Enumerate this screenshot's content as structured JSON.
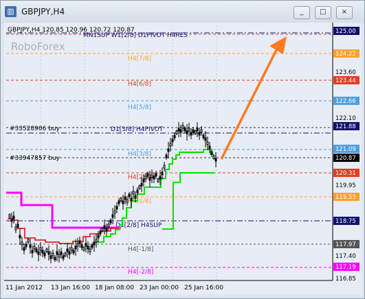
{
  "window": {
    "title": "GBPJPY,H4",
    "controls": [
      "_",
      "□",
      "×"
    ]
  },
  "chart": {
    "header": "GBPJPY,H4  120.85 120.96 120.72 120.87",
    "watermark": "RoboForex",
    "orders": [
      "#33528906 buy",
      "#33947857 buy"
    ],
    "level_labels": {
      "top": "MN1SUP W1[2/8] D1PIVOT H4RES",
      "h4_7_8": "H4[7/8]",
      "h4_6_8": "H4[6/8]",
      "h4_5_8": "H4[5/8]",
      "d1pivot": "D1[3/8] H4PIVOT",
      "h4_3_8": "H4[3/8]",
      "h4_2_8": "H4[2/8]",
      "h4_1_8": "H4[1/8]",
      "h4sup": "D1[2/8] H4SUP",
      "h4_m1_8": "H4[-1/8]",
      "h4_m2_8": "H4[-2/8]"
    },
    "price_axis": [
      "125.00",
      "124.22",
      "123.60",
      "123.44",
      "122.66",
      "122.10",
      "121.88",
      "121.09",
      "120.87",
      "120.31",
      "119.95",
      "119.53",
      "118.75",
      "117.97",
      "117.40",
      "117.19",
      "116.85"
    ],
    "time_axis": [
      "11 Jan 2012",
      "13 Jan 16:00",
      "18 Jan 08:00",
      "23 Jan 00:00",
      "25 Jan 16:00"
    ],
    "colors": {
      "background": "#e8ecf5",
      "resistance": "#e04020",
      "support": "#4da0e0",
      "orange": "#ffa030",
      "magenta": "#ff00ff",
      "navy": "#101070",
      "arrow": "#ff7a20"
    }
  }
}
